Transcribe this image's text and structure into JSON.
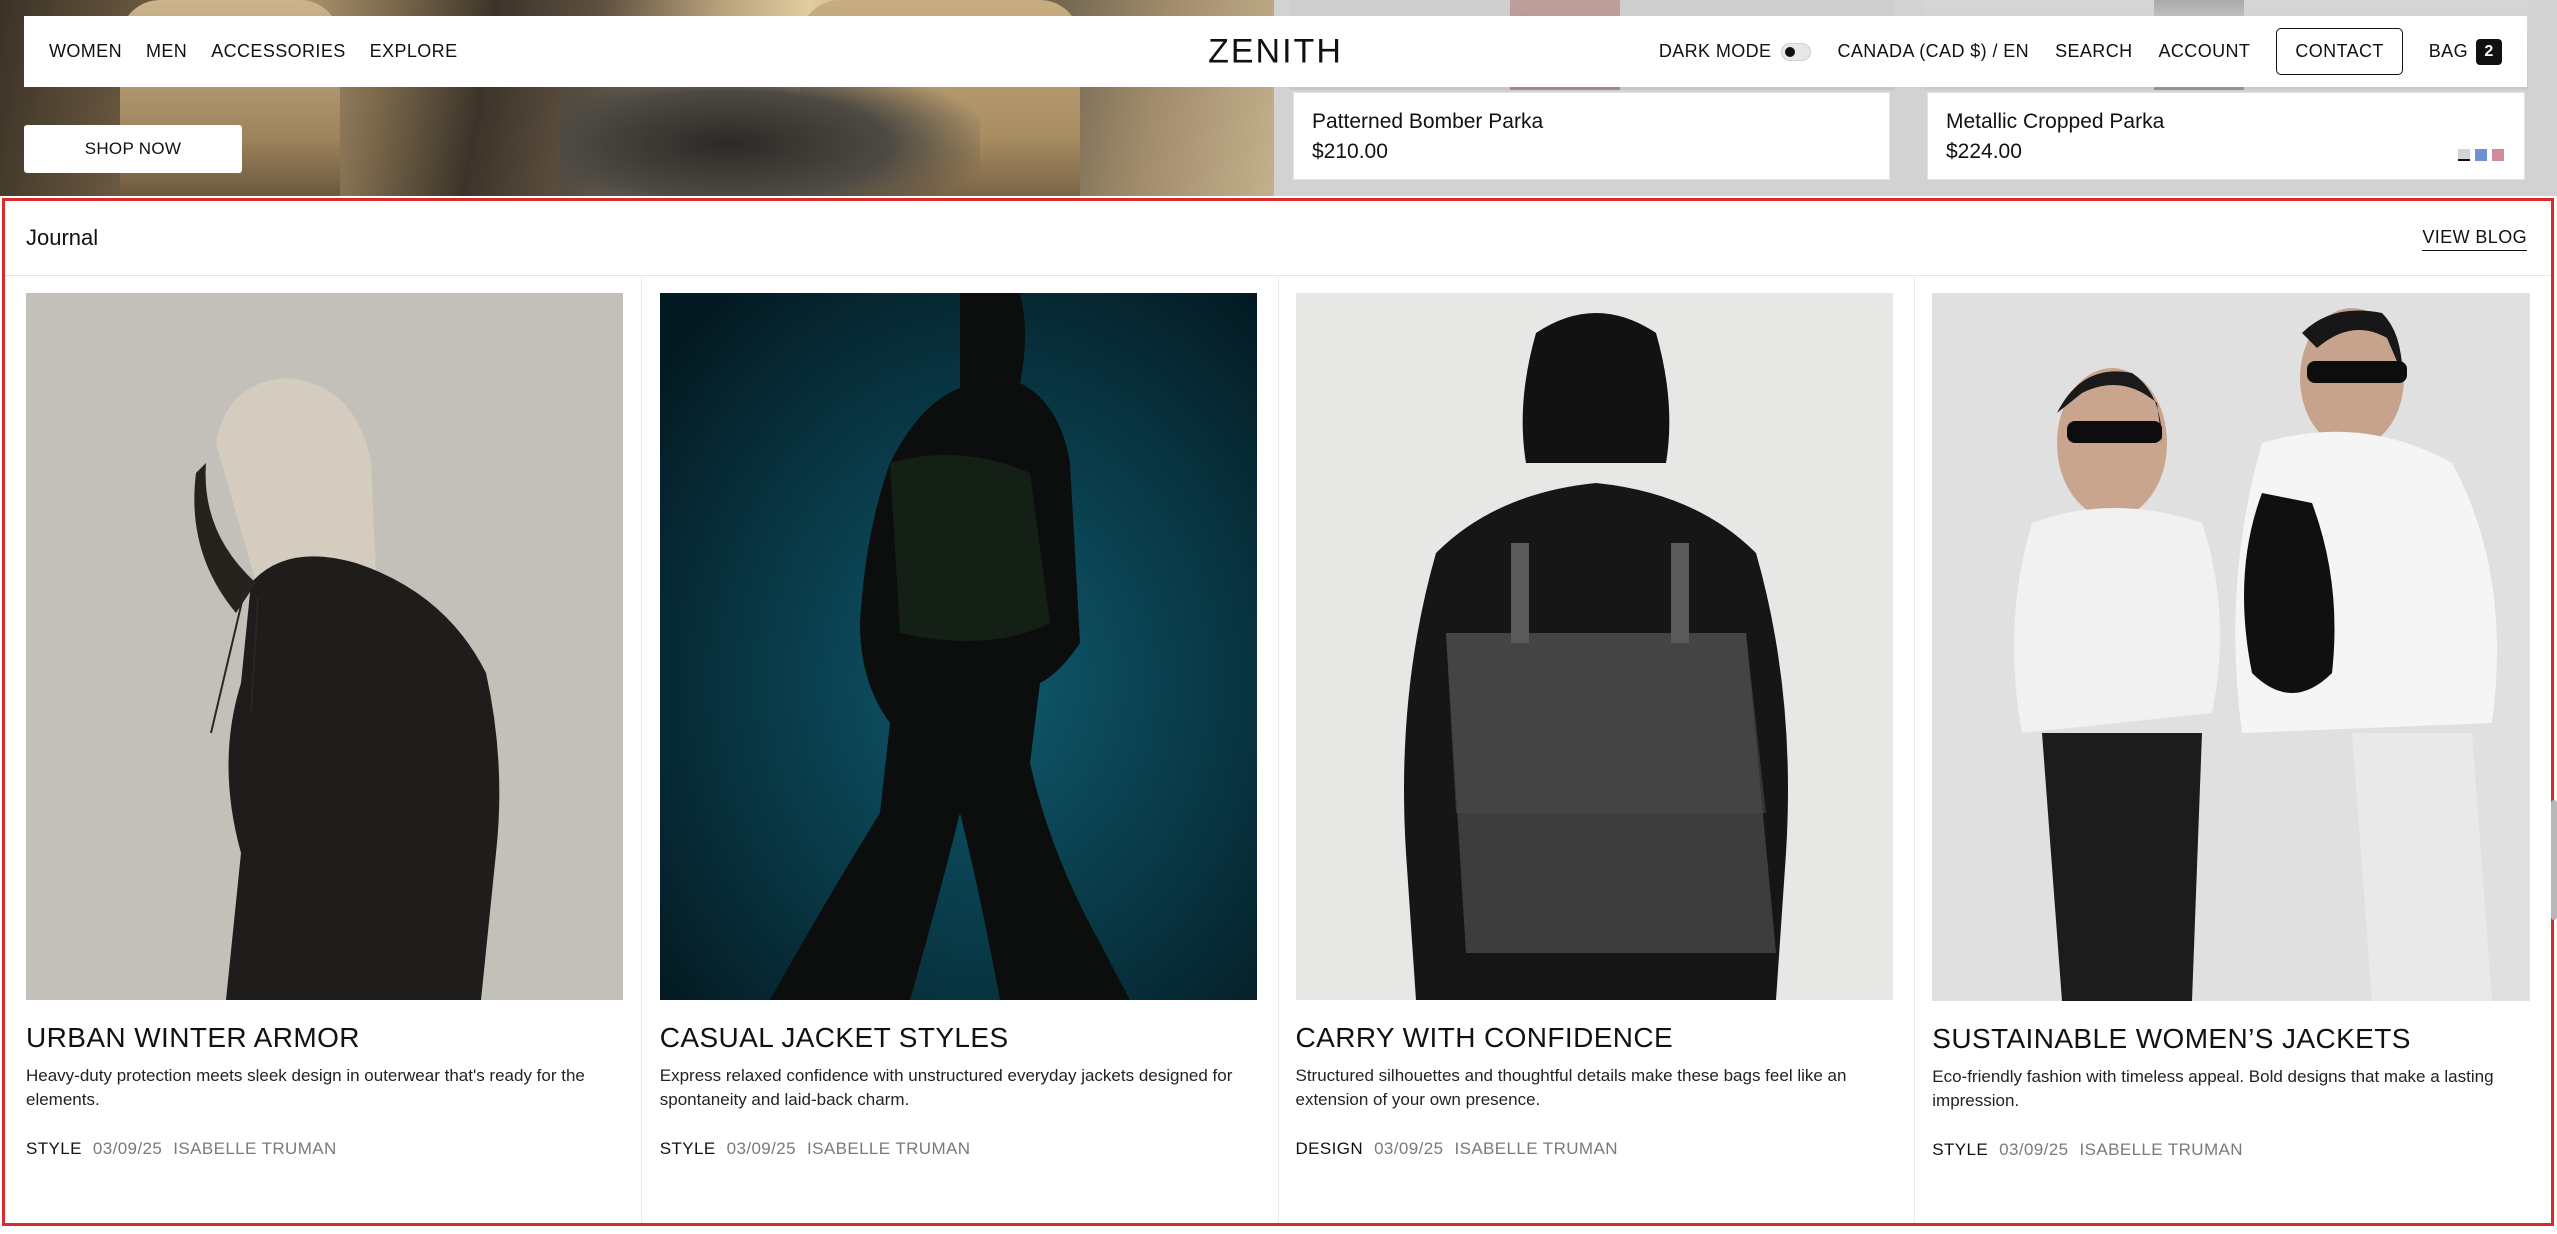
{
  "nav": {
    "left_items": [
      "WOMEN",
      "MEN",
      "ACCESSORIES",
      "EXPLORE"
    ],
    "logo": "ZENITH",
    "dark_mode_label": "DARK MODE",
    "locale": "CANADA (CAD $) / EN",
    "search": "SEARCH",
    "account": "ACCOUNT",
    "contact": "CONTACT",
    "bag_label": "BAG",
    "bag_count": "2"
  },
  "hero": {
    "shop_now": "SHOP NOW"
  },
  "products": [
    {
      "name": "Patterned Bomber Parka",
      "price": "$210.00"
    },
    {
      "name": "Metallic Cropped Parka",
      "price": "$224.00",
      "swatches": [
        "#d4d4d8",
        "#6f93d2",
        "#d08a9a"
      ]
    }
  ],
  "journal": {
    "title": "Journal",
    "view_blog": "VIEW BLOG",
    "articles": [
      {
        "title": "URBAN WINTER ARMOR",
        "description": "Heavy-duty protection meets sleek design in outerwear that's ready for the elements.",
        "category": "STYLE",
        "date": "03/09/25",
        "author": "ISABELLE TRUMAN"
      },
      {
        "title": "CASUAL JACKET STYLES",
        "description": "Express relaxed confidence with unstructured everyday jackets designed for spontaneity and laid-back charm.",
        "category": "STYLE",
        "date": "03/09/25",
        "author": "ISABELLE TRUMAN"
      },
      {
        "title": "CARRY WITH CONFIDENCE",
        "description": "Structured silhouettes and thoughtful details make these bags feel like an extension of your own presence.",
        "category": "DESIGN",
        "date": "03/09/25",
        "author": "ISABELLE TRUMAN"
      },
      {
        "title": "SUSTAINABLE WOMEN’S JACKETS",
        "description": "Eco-friendly fashion with timeless appeal. Bold designs that make a lasting impression.",
        "category": "STYLE",
        "date": "03/09/25",
        "author": "ISABELLE TRUMAN"
      }
    ]
  }
}
